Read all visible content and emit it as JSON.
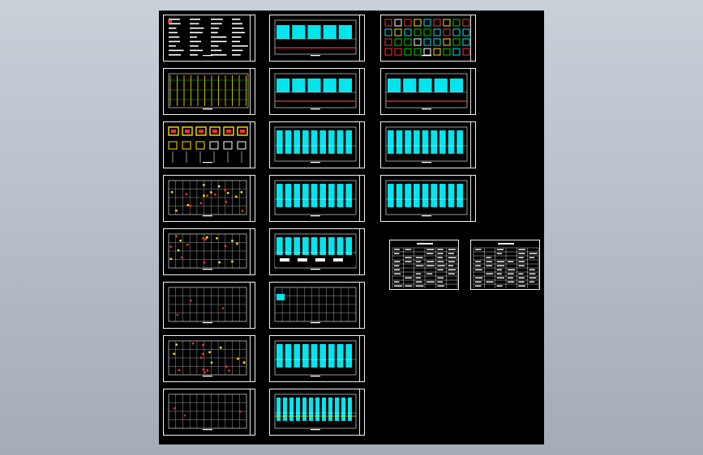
{
  "canvas": {
    "background": "#000000",
    "linework": "#ffffff",
    "accent_cyan": "#00e5ee",
    "accent_yellow": "#ffe000",
    "accent_red": "#ff3030",
    "accent_green": "#00d000"
  },
  "columns": [
    {
      "name": "column-1",
      "sheets": [
        "notes",
        "elevation",
        "details-yellow",
        "plan-red",
        "plan-red",
        "plan-grid",
        "plan-red",
        "plan-grid"
      ]
    },
    {
      "name": "column-2",
      "sheets": [
        "cyan-section",
        "cyan-section",
        "cyan-wall",
        "cyan-wall",
        "cyan-mixed",
        "plan-grid-cyan",
        "cyan-wall",
        "cyan-plan"
      ]
    },
    {
      "name": "column-3",
      "sheets": [
        "details-color",
        "cyan-section",
        "cyan-wall",
        "cyan-wall"
      ]
    }
  ],
  "tables": [
    {
      "name": "schedule-table-1"
    },
    {
      "name": "schedule-table-2"
    }
  ]
}
